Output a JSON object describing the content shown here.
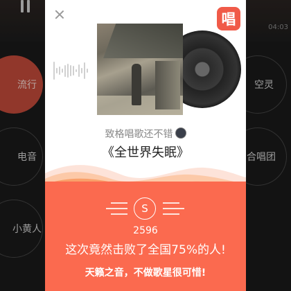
{
  "background": {
    "time": "04:03",
    "genres": [
      "流行",
      "空灵",
      "电音",
      "合唱团",
      "小黄人"
    ]
  },
  "dialog": {
    "singer_name": "致格唱歌还不错",
    "song_title": "《全世界失眠》",
    "app_logo_text": "唱",
    "grade": "S",
    "score": "2596",
    "beat_text": "这次竟然击败了全国75%的人!",
    "praise_text": "天籁之音，不做歌星很可惜!",
    "beat_percent": 75
  },
  "colors": {
    "accent": "#fb6a4f",
    "logo": "#f05a48"
  },
  "icons": [
    "close-icon",
    "pause-icon",
    "singer-avatar-icon"
  ]
}
